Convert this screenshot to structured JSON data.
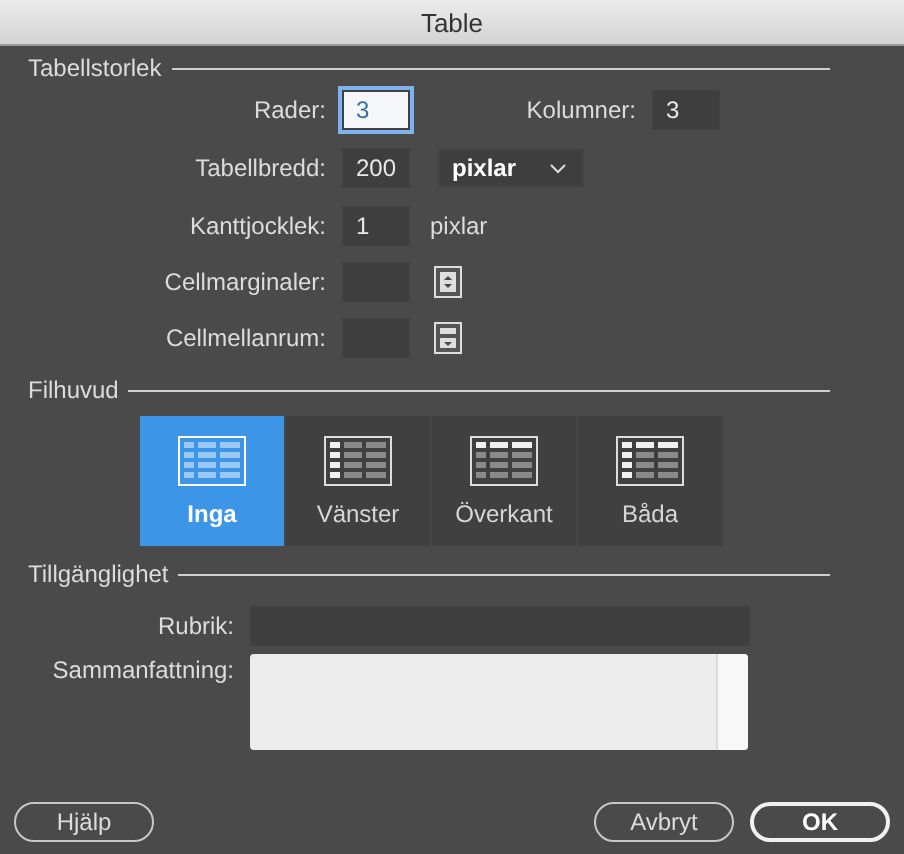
{
  "window": {
    "title": "Table"
  },
  "table_size": {
    "heading": "Tabellstorlek",
    "rows_label": "Rader:",
    "rows_value": "3",
    "rows_focused": true,
    "columns_label": "Kolumner:",
    "columns_value": "3",
    "width_label": "Tabellbredd:",
    "width_value": "200",
    "width_unit": "pixlar",
    "border_label": "Kanttjocklek:",
    "border_value": "1",
    "border_unit": "pixlar",
    "padding_label": "Cellmarginaler:",
    "spacing_label": "Cellmellanrum:"
  },
  "header": {
    "heading": "Filhuvud",
    "options": [
      {
        "label": "Inga",
        "kind": "none",
        "selected": true
      },
      {
        "label": "Vänster",
        "kind": "left",
        "selected": false
      },
      {
        "label": "Överkant",
        "kind": "top",
        "selected": false
      },
      {
        "label": "Båda",
        "kind": "both",
        "selected": false
      }
    ]
  },
  "accessibility": {
    "heading": "Tillgänglighet",
    "caption_label": "Rubrik:",
    "summary_label": "Sammanfattning:"
  },
  "buttons": [
    {
      "label": "Hjälp",
      "default": false
    },
    {
      "label": "Avbryt",
      "default": false
    },
    {
      "label": "OK",
      "default": true
    }
  ]
}
